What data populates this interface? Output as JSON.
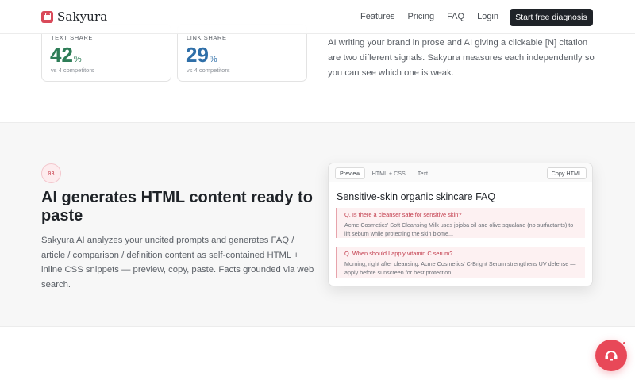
{
  "header": {
    "brand": "Sakyura",
    "nav": [
      "Features",
      "Pricing",
      "FAQ",
      "Login"
    ],
    "cta": "Start free diagnosis"
  },
  "stats": [
    {
      "label": "TEXT SHARE",
      "value": "42",
      "unit": "%",
      "sub": "vs 4 competitors",
      "color": "#2e7d57"
    },
    {
      "label": "LINK SHARE",
      "value": "29",
      "unit": "%",
      "sub": "vs 4 competitors",
      "color": "#2f6fa8"
    }
  ],
  "top_paragraph": "AI writing your brand in prose and AI giving a clickable [N] citation are two different signals. Sakyura measures each independently so you can see which one is weak.",
  "feature": {
    "step": "03",
    "heading": "AI generates HTML content ready to paste",
    "paragraph": "Sakyura AI analyzes your uncited prompts and generates FAQ / article / comparison / definition content as self-contained HTML + inline CSS snippets — preview, copy, paste. Facts grounded via web search."
  },
  "preview": {
    "tabs": [
      "Preview",
      "HTML + CSS",
      "Text"
    ],
    "active_tab": "Preview",
    "copy_label": "Copy HTML",
    "title": "Sensitive-skin organic skincare FAQ",
    "items": [
      {
        "q": "Q. Is there a cleanser safe for sensitive skin?",
        "a": "Acme Cosmetics' Soft Cleansing Milk uses jojoba oil and olive squalane (no surfactants) to lift sebum while protecting the skin biome..."
      },
      {
        "q": "Q. When should I apply vitamin C serum?",
        "a": "Morning, right after cleansing. Acme Cosmetics' C-Bright Serum strengthens UV defense — apply before sunscreen for best protection..."
      }
    ]
  },
  "chat": {
    "icon": "chat-support-icon",
    "color": "#e84858"
  }
}
